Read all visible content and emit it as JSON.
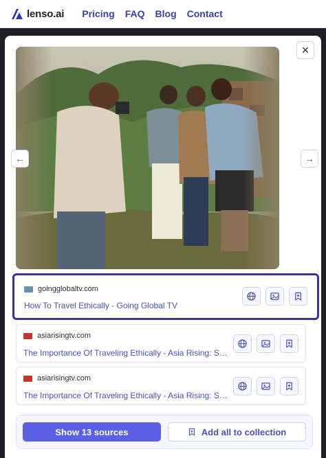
{
  "nav": {
    "logo_text": "lenso.ai",
    "links": [
      "Pricing",
      "FAQ",
      "Blog",
      "Contact"
    ]
  },
  "viewer": {
    "close_glyph": "✕",
    "prev_glyph": "←",
    "next_glyph": "→",
    "image_icon": "photo-of-travelers"
  },
  "results": [
    {
      "domain": "goingglobaltv.com",
      "title": "How To Travel Ethically - Going Global TV",
      "selected": true,
      "favicon_color": "#6a8fb5"
    },
    {
      "domain": "asiarisingtv.com",
      "title": "The Importance Of Traveling Ethically - Asia Rising: Stor...",
      "selected": false,
      "favicon_color": "#c0392b"
    },
    {
      "domain": "asiarisingtv.com",
      "title": "The Importance Of Traveling Ethically - Asia Rising: Stor...",
      "selected": false,
      "favicon_color": "#c0392b"
    }
  ],
  "footer": {
    "show_sources_label": "Show 13 sources",
    "add_collection_label": "Add all to collection"
  },
  "colors": {
    "accent": "#5c60e6",
    "link": "#4b4fbf",
    "selected_border": "#3d2f9e"
  }
}
